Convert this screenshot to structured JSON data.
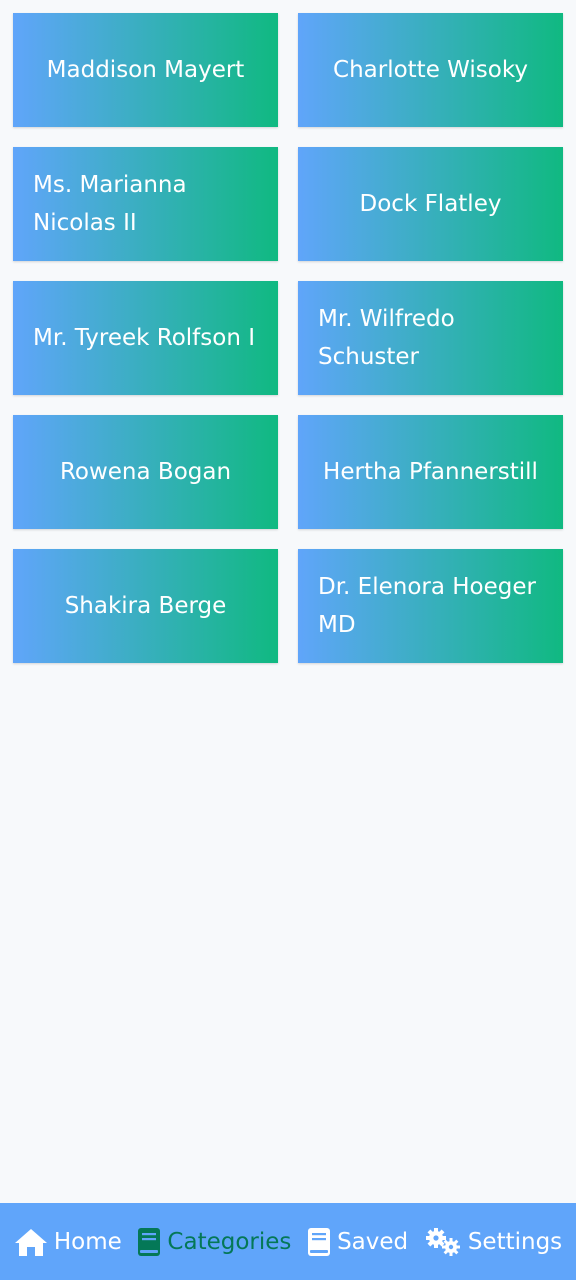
{
  "cards": [
    {
      "label": "Maddison Mayert"
    },
    {
      "label": "Charlotte Wisoky"
    },
    {
      "label": "Ms. Marianna Nicolas II"
    },
    {
      "label": "Dock Flatley"
    },
    {
      "label": "Mr. Tyreek Rolfson I"
    },
    {
      "label": "Mr. Wilfredo Schuster"
    },
    {
      "label": "Rowena Bogan"
    },
    {
      "label": "Hertha Pfannerstill"
    },
    {
      "label": "Shakira Berge"
    },
    {
      "label": "Dr. Elenora Hoeger MD"
    }
  ],
  "nav": {
    "items": [
      {
        "label": "Home",
        "icon": "home-icon",
        "active": false
      },
      {
        "label": "Categories",
        "icon": "book-icon",
        "active": true
      },
      {
        "label": "Saved",
        "icon": "book-icon",
        "active": false
      },
      {
        "label": "Settings",
        "icon": "gears-icon",
        "active": false
      }
    ]
  },
  "colors": {
    "gradient_start": "#60a5fa",
    "gradient_end": "#10b981",
    "nav_background": "#60a5fa",
    "active": "#047857",
    "page_background": "#f7f9fb"
  }
}
